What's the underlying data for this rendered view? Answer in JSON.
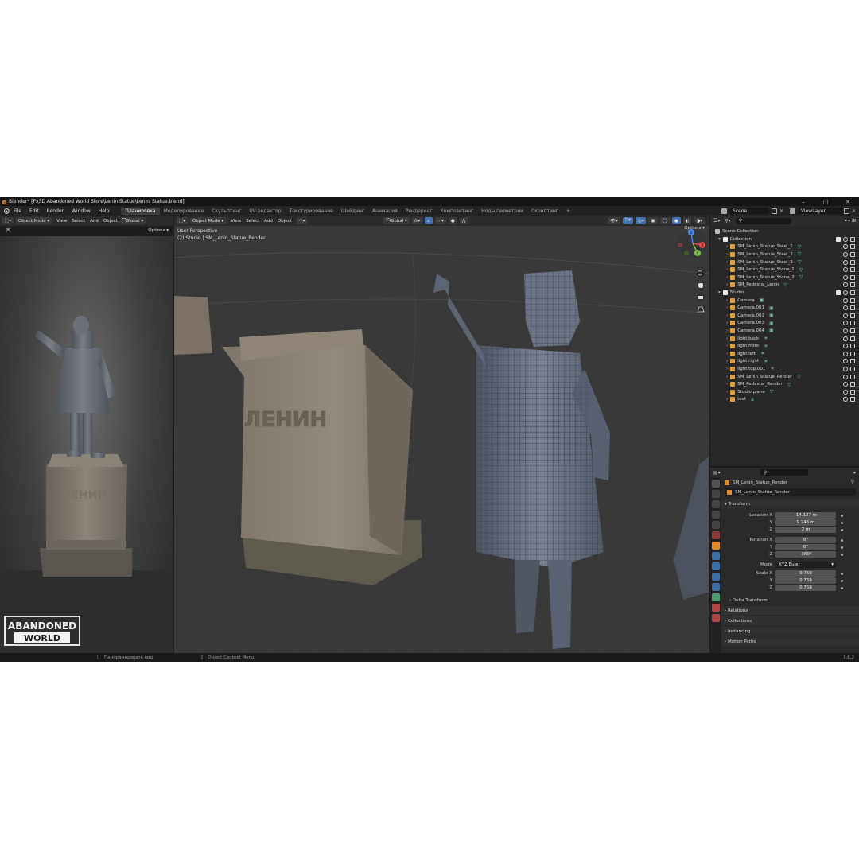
{
  "titlebar": {
    "title": "Blender* [F:\\3D Abandoned World Store\\Lenin Statue\\Lenin_Statue.blend]"
  },
  "menu": {
    "items": [
      "File",
      "Edit",
      "Render",
      "Window",
      "Help"
    ],
    "workspaces": [
      "Планировка",
      "Моделирование",
      "Скульптинг",
      "UV-редактор",
      "Текстурирование",
      "Шейдинг",
      "Анимация",
      "Рендеринг",
      "Композитинг",
      "Ноды геометрии",
      "Скриптинг"
    ],
    "active_workspace": "Планировка",
    "add_tab": "+",
    "scene": "Scene",
    "view_layer": "ViewLayer"
  },
  "left_editor": {
    "mode": "Object Mode",
    "menus": [
      "View",
      "Select",
      "Add",
      "Object"
    ],
    "orientation": "Global",
    "options": "Options"
  },
  "viewport": {
    "mode": "Object Mode",
    "menus": [
      "View",
      "Select",
      "Add",
      "Object"
    ],
    "orientation": "Global",
    "options": "Options",
    "overlay_line1": "User Perspective",
    "overlay_line2": "(2) Studio | SM_Lenin_Statue_Render",
    "pedestal_text": "ЛЕНИН",
    "gizmo_labels": [
      "X",
      "Y",
      "Z"
    ]
  },
  "render_preview": {
    "pedestal_text": "ЛЕНИН",
    "logo_line1": "ABANDONED",
    "logo_line2": "WORLD"
  },
  "outliner": {
    "root": "Scene Collection",
    "collections": [
      {
        "name": "Collection",
        "items": [
          "SM_Lenin_Statue_Steel_1",
          "SM_Lenin_Statue_Steel_2",
          "SM_Lenin_Statue_Steel_3",
          "SM_Lenin_Statue_Stone_1",
          "SM_Lenin_Statue_Stone_2",
          "SM_Pedestal_Lenin"
        ]
      },
      {
        "name": "Studio",
        "items": [
          "Camera",
          "Camera.001",
          "Camera.002",
          "Camera.003",
          "Camera.004",
          "light back",
          "light front",
          "light left",
          "light right",
          "light top.001",
          "SM_Lenin_Statue_Render",
          "SM_Pedestal_Render",
          "Studio plane",
          "text"
        ]
      }
    ]
  },
  "properties": {
    "object_name": "SM_Lenin_Statue_Render",
    "data_name": "SM_Lenin_Statue_Render",
    "transform_header": "Transform",
    "location": {
      "label": "Location X",
      "x": "-14.127 m",
      "y": "9.246 m",
      "z": "2 m"
    },
    "rotation": {
      "label": "Rotation X",
      "x": "0°",
      "y": "0°",
      "z": "-360°"
    },
    "mode_label": "Mode",
    "mode_value": "XYZ Euler",
    "scale": {
      "label": "Scale X",
      "x": "0.759",
      "y": "0.759",
      "z": "0.759"
    },
    "axis_labels": [
      "Y",
      "Z"
    ],
    "sections": [
      "Delta Transform",
      "Relations",
      "Collections",
      "Instancing",
      "Motion Paths"
    ]
  },
  "statusbar": {
    "hint1": "Панорамировать вид",
    "hint2": "Object Context Menu",
    "version": "3.6.2"
  },
  "colors": {
    "accent": "#4772b3",
    "mesh_green": "#5bd1a4",
    "camera_green": "#7ac4a0",
    "light_orange": "#e0a03c"
  }
}
